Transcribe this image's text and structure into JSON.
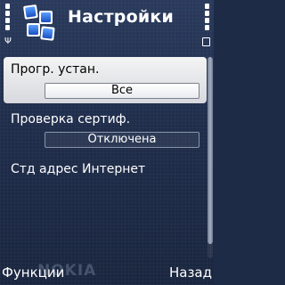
{
  "header": {
    "title": "Настройки",
    "app_icon": "settings-squares-icon",
    "signal_icon": "signal-strength-icon",
    "battery_icon": "battery-icon"
  },
  "settings": {
    "items": [
      {
        "label": "Прогр. устан.",
        "value": "Все",
        "selected": true
      },
      {
        "label": "Проверка сертиф.",
        "value": "Отключена",
        "selected": false
      },
      {
        "label": "Стд адрес Интернет",
        "value": "",
        "selected": false
      }
    ]
  },
  "softkeys": {
    "left": "Функции",
    "right": "Назад"
  },
  "watermark": "NOKIA",
  "colors": {
    "background": "#1f2d4b",
    "selection": "#e6e7eb",
    "icon_blue": "#2a66d8"
  }
}
